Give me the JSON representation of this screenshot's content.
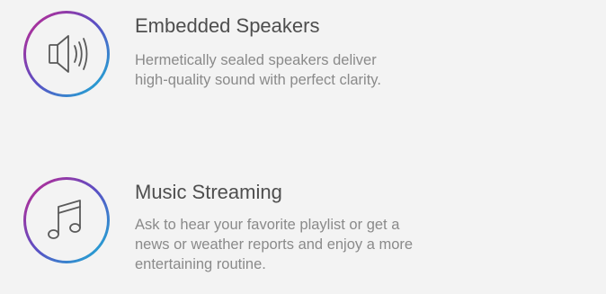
{
  "features": [
    {
      "icon": "speaker-icon",
      "title": "Embedded Speakers",
      "description_lines": [
        "Hermetically sealed speakers deliver",
        "high-quality sound with perfect clarity."
      ]
    },
    {
      "icon": "music-note-icon",
      "title": "Music Streaming",
      "description_lines": [
        "Ask to hear your favorite playlist or get a",
        "news or weather reports and enjoy a more",
        "entertaining routine."
      ]
    }
  ],
  "colors": {
    "background": "#f3f3f3",
    "title": "#4e4e4e",
    "description": "#8a8a8a",
    "ring_gradient_start": "#c2278f",
    "ring_gradient_mid": "#5a4fc4",
    "ring_gradient_end": "#18b5d6",
    "icon_stroke": "#5a5a5a"
  }
}
